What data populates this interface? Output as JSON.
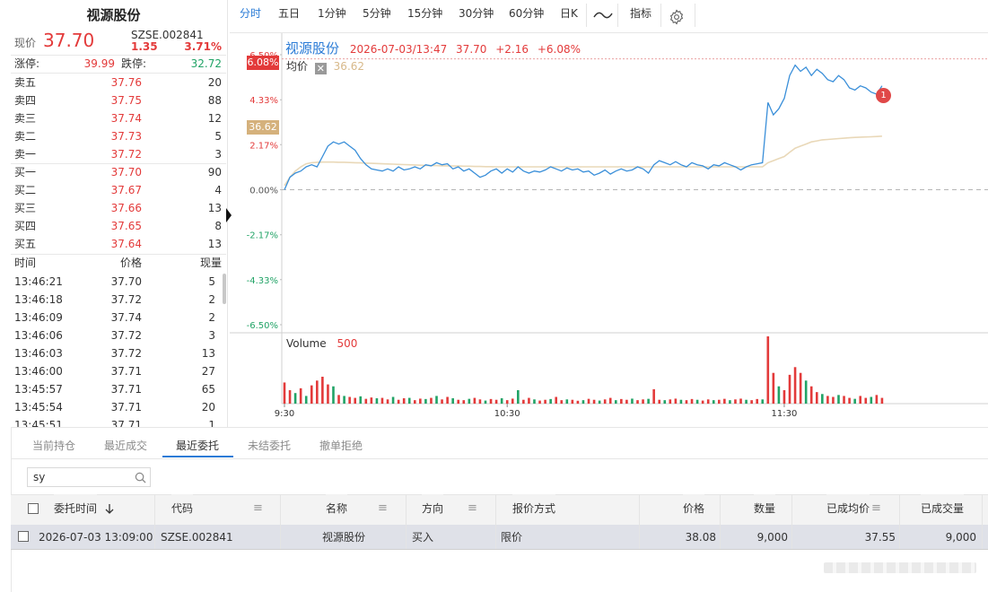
{
  "stock": {
    "name": "视源股份",
    "code": "SZSE.002841",
    "price_label": "现价",
    "price": "37.70",
    "change": "1.35",
    "change_pct": "3.71%",
    "limit_up_label": "涨停:",
    "limit_up": "39.99",
    "limit_down_label": "跌停:",
    "limit_down": "32.72"
  },
  "orderbook": [
    {
      "label": "卖五",
      "price": "37.76",
      "vol": "20"
    },
    {
      "label": "卖四",
      "price": "37.75",
      "vol": "88"
    },
    {
      "label": "卖三",
      "price": "37.74",
      "vol": "12"
    },
    {
      "label": "卖二",
      "price": "37.73",
      "vol": "5"
    },
    {
      "label": "卖一",
      "price": "37.72",
      "vol": "3"
    },
    {
      "label": "买一",
      "price": "37.70",
      "vol": "90"
    },
    {
      "label": "买二",
      "price": "37.67",
      "vol": "4"
    },
    {
      "label": "买三",
      "price": "37.66",
      "vol": "13"
    },
    {
      "label": "买四",
      "price": "37.65",
      "vol": "8"
    },
    {
      "label": "买五",
      "price": "37.64",
      "vol": "13"
    }
  ],
  "ticks_header": {
    "time": "时间",
    "price": "价格",
    "vol": "现量"
  },
  "ticks": [
    {
      "time": "13:46:21",
      "price": "37.70",
      "vol": "5",
      "dir": "up"
    },
    {
      "time": "13:46:18",
      "price": "37.72",
      "vol": "2",
      "dir": "up"
    },
    {
      "time": "13:46:09",
      "price": "37.74",
      "vol": "2",
      "dir": "up"
    },
    {
      "time": "13:46:06",
      "price": "37.72",
      "vol": "3",
      "dir": "up"
    },
    {
      "time": "13:46:03",
      "price": "37.72",
      "vol": "13",
      "dir": "up"
    },
    {
      "time": "13:46:00",
      "price": "37.71",
      "vol": "27",
      "dir": "up"
    },
    {
      "time": "13:45:57",
      "price": "37.71",
      "vol": "65",
      "dir": "up"
    },
    {
      "time": "13:45:54",
      "price": "37.71",
      "vol": "20",
      "dir": "up"
    },
    {
      "time": "13:45:51",
      "price": "37.71",
      "vol": "1",
      "dir": "up"
    }
  ],
  "tabs": [
    "分时",
    "五日",
    "1分钟",
    "5分钟",
    "15分钟",
    "30分钟",
    "60分钟",
    "日K"
  ],
  "tab_indicator": "指标",
  "chart_info": {
    "name": "视源股份",
    "datetime": "2026-07-03/13:47",
    "price": "37.70",
    "change": "+2.16",
    "change_pct": "+6.08%",
    "avg_label": "均价",
    "avg_value": "36.62",
    "badge_current": "6.08%",
    "badge_avg": "36.62",
    "volume_label": "Volume",
    "volume_value": "500",
    "event_marker": "1"
  },
  "chart_data": {
    "type": "line",
    "y_axis_labels": [
      "6.50%",
      "4.33%",
      "2.17%",
      "0.00%",
      "-2.17%",
      "-4.33%",
      "-6.50%"
    ],
    "ylim": [
      -6.5,
      6.5
    ],
    "x_ticks": [
      "9:30",
      "10:30",
      "11:30"
    ],
    "series": [
      {
        "values": [
          0.0,
          0.6,
          0.8,
          0.9,
          1.1,
          1.2,
          1.1,
          1.6,
          2.1,
          2.3,
          2.2,
          2.3,
          2.1,
          1.9,
          1.5,
          1.2,
          1.0,
          0.95,
          0.9,
          1.0,
          0.9,
          1.1,
          0.95,
          1.0,
          1.1,
          1.0,
          1.2,
          1.15,
          1.3,
          1.2,
          1.25,
          1.0,
          1.1,
          0.9,
          1.0,
          0.8,
          0.6,
          0.7,
          0.9,
          1.0,
          0.8,
          1.0,
          0.85,
          1.1,
          0.9,
          0.8,
          0.9,
          0.85,
          0.95,
          1.1,
          1.0,
          0.9,
          1.05,
          0.95,
          1.0,
          0.85,
          0.9,
          0.7,
          0.8,
          0.95,
          0.75,
          0.9,
          1.0,
          0.9,
          0.95,
          1.1,
          1.0,
          0.8,
          1.2,
          1.4,
          1.3,
          1.2,
          1.35,
          1.2,
          1.1,
          1.3,
          1.2,
          1.15,
          1.0,
          1.2,
          1.15,
          1.3,
          1.2,
          1.1,
          0.95,
          1.1,
          1.2,
          1.25,
          1.3,
          4.2,
          3.6,
          3.9,
          4.4,
          5.5,
          6.0,
          5.7,
          5.9,
          5.5,
          5.8,
          5.6,
          5.3,
          5.2,
          5.5,
          5.3,
          4.9,
          4.8,
          5.0,
          4.9,
          4.7,
          4.6,
          5.0
        ]
      },
      {
        "values": [
          0.2,
          0.6,
          0.9,
          1.1,
          1.25,
          1.3,
          1.32,
          1.33,
          1.33,
          1.33,
          1.32,
          1.32,
          1.31,
          1.3,
          1.29,
          1.28,
          1.27,
          1.26,
          1.25,
          1.24,
          1.23,
          1.22,
          1.21,
          1.2,
          1.19,
          1.18,
          1.17,
          1.16,
          1.16,
          1.15,
          1.15,
          1.14,
          1.14,
          1.13,
          1.13,
          1.12,
          1.12,
          1.11,
          1.11,
          1.1,
          1.1,
          1.1,
          1.1,
          1.1,
          1.1,
          1.1,
          1.1,
          1.1,
          1.1,
          1.1,
          1.1,
          1.1,
          1.1,
          1.1,
          1.1,
          1.1,
          1.1,
          1.1,
          1.1,
          1.1,
          1.1,
          1.1,
          1.1,
          1.1,
          1.1,
          1.1,
          1.1,
          1.1,
          1.1,
          1.1,
          1.1,
          1.1,
          1.1,
          1.1,
          1.1,
          1.1,
          1.1,
          1.1,
          1.1,
          1.1,
          1.1,
          1.1,
          1.1,
          1.1,
          1.1,
          1.1,
          1.1,
          1.1,
          1.1,
          1.3,
          1.4,
          1.5,
          1.6,
          1.8,
          2.0,
          2.1,
          2.2,
          2.3,
          2.35,
          2.4,
          2.42,
          2.44,
          2.46,
          2.48,
          2.5,
          2.52,
          2.53,
          2.54,
          2.55,
          2.56,
          2.58
        ]
      }
    ],
    "volume": [
      {
        "v": 110,
        "c": "r"
      },
      {
        "v": 70,
        "c": "r"
      },
      {
        "v": 55,
        "c": "g"
      },
      {
        "v": 80,
        "c": "r"
      },
      {
        "v": 40,
        "c": "g"
      },
      {
        "v": 95,
        "c": "r"
      },
      {
        "v": 120,
        "c": "r"
      },
      {
        "v": 140,
        "c": "r"
      },
      {
        "v": 100,
        "c": "r"
      },
      {
        "v": 90,
        "c": "g"
      },
      {
        "v": 45,
        "c": "r"
      },
      {
        "v": 40,
        "c": "g"
      },
      {
        "v": 35,
        "c": "r"
      },
      {
        "v": 30,
        "c": "r"
      },
      {
        "v": 38,
        "c": "g"
      },
      {
        "v": 25,
        "c": "r"
      },
      {
        "v": 32,
        "c": "r"
      },
      {
        "v": 28,
        "c": "g"
      },
      {
        "v": 30,
        "c": "r"
      },
      {
        "v": 22,
        "c": "r"
      },
      {
        "v": 35,
        "c": "g"
      },
      {
        "v": 20,
        "c": "r"
      },
      {
        "v": 28,
        "c": "r"
      },
      {
        "v": 30,
        "c": "g"
      },
      {
        "v": 18,
        "c": "r"
      },
      {
        "v": 26,
        "c": "r"
      },
      {
        "v": 24,
        "c": "g"
      },
      {
        "v": 30,
        "c": "r"
      },
      {
        "v": 40,
        "c": "g"
      },
      {
        "v": 22,
        "c": "r"
      },
      {
        "v": 35,
        "c": "r"
      },
      {
        "v": 28,
        "c": "g"
      },
      {
        "v": 20,
        "c": "r"
      },
      {
        "v": 18,
        "c": "r"
      },
      {
        "v": 25,
        "c": "g"
      },
      {
        "v": 30,
        "c": "r"
      },
      {
        "v": 22,
        "c": "r"
      },
      {
        "v": 16,
        "c": "g"
      },
      {
        "v": 24,
        "c": "r"
      },
      {
        "v": 20,
        "c": "r"
      },
      {
        "v": 28,
        "c": "g"
      },
      {
        "v": 18,
        "c": "r"
      },
      {
        "v": 26,
        "c": "r"
      },
      {
        "v": 70,
        "c": "g"
      },
      {
        "v": 20,
        "c": "r"
      },
      {
        "v": 30,
        "c": "r"
      },
      {
        "v": 22,
        "c": "g"
      },
      {
        "v": 16,
        "c": "r"
      },
      {
        "v": 20,
        "c": "r"
      },
      {
        "v": 24,
        "c": "g"
      },
      {
        "v": 35,
        "c": "r"
      },
      {
        "v": 18,
        "c": "r"
      },
      {
        "v": 22,
        "c": "g"
      },
      {
        "v": 20,
        "c": "r"
      },
      {
        "v": 15,
        "c": "r"
      },
      {
        "v": 18,
        "c": "g"
      },
      {
        "v": 25,
        "c": "r"
      },
      {
        "v": 20,
        "c": "r"
      },
      {
        "v": 16,
        "c": "g"
      },
      {
        "v": 22,
        "c": "r"
      },
      {
        "v": 30,
        "c": "r"
      },
      {
        "v": 18,
        "c": "g"
      },
      {
        "v": 24,
        "c": "r"
      },
      {
        "v": 20,
        "c": "r"
      },
      {
        "v": 26,
        "c": "g"
      },
      {
        "v": 18,
        "c": "r"
      },
      {
        "v": 22,
        "c": "r"
      },
      {
        "v": 25,
        "c": "g"
      },
      {
        "v": 75,
        "c": "r"
      },
      {
        "v": 20,
        "c": "r"
      },
      {
        "v": 18,
        "c": "g"
      },
      {
        "v": 22,
        "c": "r"
      },
      {
        "v": 26,
        "c": "r"
      },
      {
        "v": 20,
        "c": "g"
      },
      {
        "v": 18,
        "c": "r"
      },
      {
        "v": 24,
        "c": "r"
      },
      {
        "v": 20,
        "c": "g"
      },
      {
        "v": 16,
        "c": "r"
      },
      {
        "v": 22,
        "c": "r"
      },
      {
        "v": 18,
        "c": "g"
      },
      {
        "v": 20,
        "c": "r"
      },
      {
        "v": 25,
        "c": "r"
      },
      {
        "v": 18,
        "c": "g"
      },
      {
        "v": 22,
        "c": "r"
      },
      {
        "v": 26,
        "c": "r"
      },
      {
        "v": 20,
        "c": "g"
      },
      {
        "v": 18,
        "c": "r"
      },
      {
        "v": 24,
        "c": "r"
      },
      {
        "v": 22,
        "c": "g"
      },
      {
        "v": 350,
        "c": "r"
      },
      {
        "v": 160,
        "c": "r"
      },
      {
        "v": 90,
        "c": "g"
      },
      {
        "v": 70,
        "c": "r"
      },
      {
        "v": 150,
        "c": "r"
      },
      {
        "v": 190,
        "c": "r"
      },
      {
        "v": 160,
        "c": "r"
      },
      {
        "v": 120,
        "c": "g"
      },
      {
        "v": 90,
        "c": "r"
      },
      {
        "v": 60,
        "c": "r"
      },
      {
        "v": 50,
        "c": "g"
      },
      {
        "v": 40,
        "c": "r"
      },
      {
        "v": 35,
        "c": "r"
      },
      {
        "v": 45,
        "c": "g"
      },
      {
        "v": 40,
        "c": "r"
      },
      {
        "v": 30,
        "c": "r"
      },
      {
        "v": 25,
        "c": "g"
      },
      {
        "v": 40,
        "c": "r"
      },
      {
        "v": 30,
        "c": "r"
      },
      {
        "v": 35,
        "c": "g"
      },
      {
        "v": 45,
        "c": "r"
      },
      {
        "v": 30,
        "c": "r"
      }
    ]
  },
  "bottom_tabs": [
    "当前持仓",
    "最近成交",
    "最近委托",
    "未结委托",
    "撤单拒绝"
  ],
  "bottom_active": "最近委托",
  "search": {
    "value": "sy"
  },
  "table": {
    "headers": [
      "委托时间",
      "代码",
      "名称",
      "方向",
      "报价方式",
      "价格",
      "数量",
      "已成均价",
      "已成交量"
    ],
    "rows": [
      [
        "2026-07-03 13:09:00",
        "SZSE.002841",
        "视源股份",
        "买入",
        "限价",
        "38.08",
        "9,000",
        "37.55",
        "9,000"
      ]
    ]
  },
  "colors": {
    "up": "#e33a3a",
    "down": "#21a366",
    "price_line": "#3a8fd9",
    "avg_line": "#e9d8b8",
    "accent": "#2a7bd6"
  }
}
